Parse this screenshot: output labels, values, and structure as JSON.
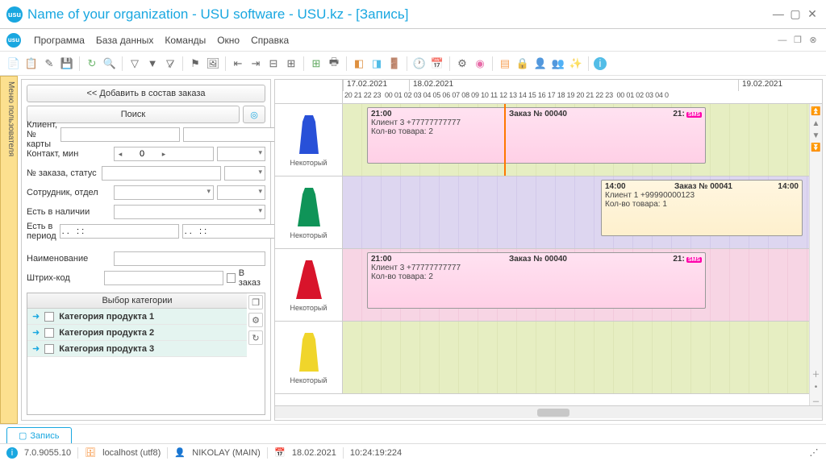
{
  "window": {
    "title": "Name of your organization - USU software - USU.kz - [Запись]"
  },
  "menu": {
    "items": [
      "Программа",
      "База данных",
      "Команды",
      "Окно",
      "Справка"
    ]
  },
  "sidetab": "Меню пользователя",
  "panel": {
    "add_btn": "<< Добавить в состав заказа",
    "search_btn": "Поиск",
    "fields": {
      "client": "Клиент, № карты",
      "contact": "Контакт, мин",
      "contact_val": "0",
      "order": "№ заказа, статус",
      "employee": "Сотрудник, отдел",
      "instock": "Есть в наличии",
      "inperiod": "Есть в период",
      "period_val": ". .   : :",
      "name": "Наименование",
      "barcode": "Штрих-код",
      "toorder": "В заказ"
    },
    "cat_header": "Выбор категории",
    "cats": [
      "Категория продукта 1",
      "Категория продукта 2",
      "Категория продукта 3"
    ]
  },
  "timeline": {
    "dates": [
      "17.02.2021",
      "18.02.2021",
      "19.02.2021"
    ],
    "hours1": "20 21 22 23",
    "hours2": "00 01 02 03 04 05 06 07 08 09 10 11 12 13 14 15 16 17 18 19 20 21 22 23",
    "hours3": "00 01 02 03 04 0",
    "prod_label": "Некоторый",
    "orders": [
      {
        "start": "21:00",
        "title": "Заказ № 00040",
        "end": "21:",
        "client": "Клиент 3 +77777777777",
        "qty": "Кол-во товара: 2",
        "badge": "SMS"
      },
      {
        "start": "14:00",
        "title": "Заказ № 00041",
        "end": "14:00",
        "client": "Клиент 1 +99990000123",
        "qty": "Кол-во товара: 1"
      },
      {
        "start": "21:00",
        "title": "Заказ № 00040",
        "end": "21:",
        "client": "Клиент 3 +77777777777",
        "qty": "Кол-во товара: 2",
        "badge": "SMS"
      }
    ]
  },
  "tab": "Запись",
  "status": {
    "version": "7.0.9055.10",
    "host": "localhost (utf8)",
    "user": "NIKOLAY (MAIN)",
    "date": "18.02.2021",
    "time": "10:24:19:224"
  }
}
